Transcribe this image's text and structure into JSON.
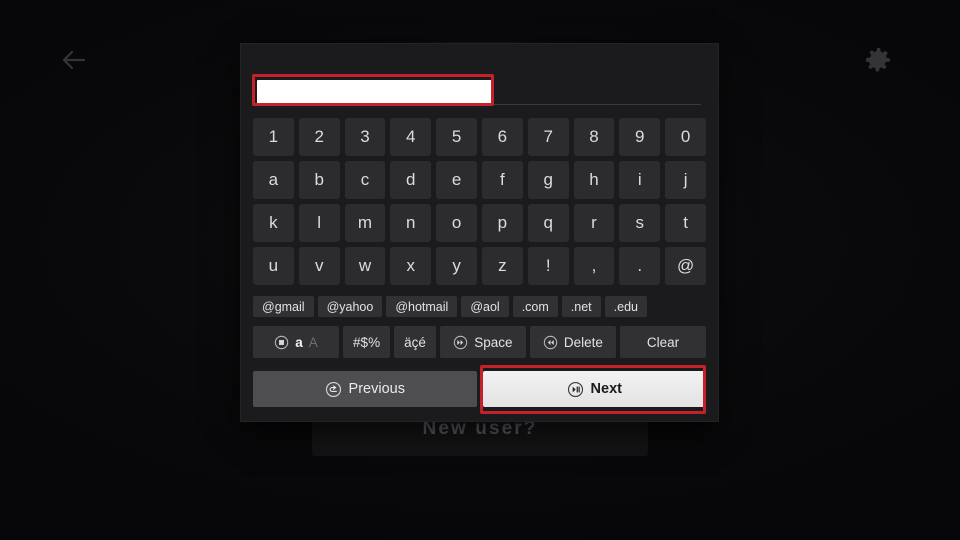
{
  "background": {
    "back_icon": "back-arrow-icon",
    "settings_icon": "gear-icon",
    "new_user_label": "New user?"
  },
  "dialog": {
    "input": {
      "value": "",
      "placeholder": "",
      "highlighted": true,
      "highlight_color": "#c4212b"
    },
    "keys": {
      "row1": [
        "1",
        "2",
        "3",
        "4",
        "5",
        "6",
        "7",
        "8",
        "9",
        "0"
      ],
      "row2": [
        "a",
        "b",
        "c",
        "d",
        "e",
        "f",
        "g",
        "h",
        "i",
        "j"
      ],
      "row3": [
        "k",
        "l",
        "m",
        "n",
        "o",
        "p",
        "q",
        "r",
        "s",
        "t"
      ],
      "row4": [
        "u",
        "v",
        "w",
        "x",
        "y",
        "z",
        "!",
        ",",
        ".",
        "@"
      ]
    },
    "suffixes": [
      "@gmail",
      "@yahoo",
      "@hotmail",
      "@aol",
      ".com",
      ".net",
      ".edu"
    ],
    "functions": {
      "case_toggle": {
        "icon": "stop-circle-icon",
        "lower": "a",
        "upper": "A"
      },
      "symbols_label": "#$%",
      "accents_label": "äçé",
      "space": {
        "icon": "fast-forward-circle-icon",
        "label": "Space"
      },
      "delete": {
        "icon": "rewind-circle-icon",
        "label": "Delete"
      },
      "clear": {
        "label": "Clear"
      }
    },
    "nav": {
      "previous": {
        "icon": "back-circle-icon",
        "label": "Previous"
      },
      "next": {
        "icon": "play-pause-circle-icon",
        "label": "Next",
        "highlighted": true,
        "highlight_color": "#c4212b"
      }
    }
  }
}
